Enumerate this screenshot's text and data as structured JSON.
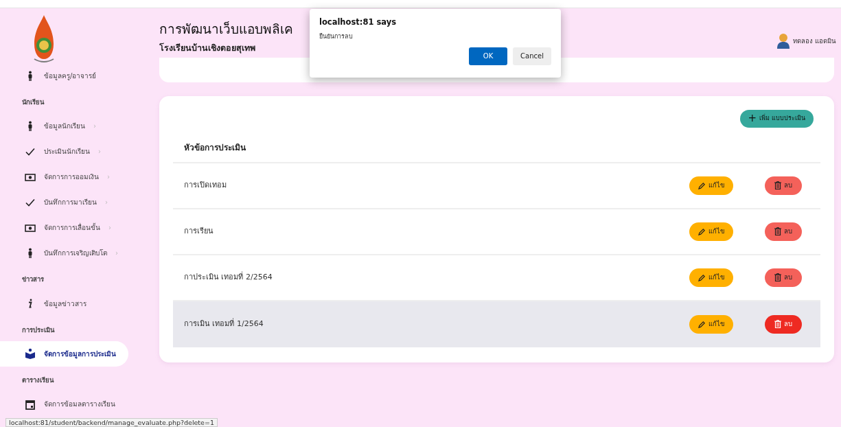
{
  "sidebar": {
    "items": [
      {
        "kind": "person",
        "label": "ข้อมูลครู/อาจารย์",
        "selected": false
      },
      {
        "kind": "section",
        "label": "นักเรียน"
      },
      {
        "kind": "person",
        "label": "ข้อมูลนักเรียน",
        "chevron": "›",
        "selected": false
      },
      {
        "kind": "check",
        "label": "ประเมินนักเรียน",
        "chevron": "›",
        "selected": false
      },
      {
        "kind": "money",
        "label": "จัดการการออมเงิน",
        "chevron": "›",
        "selected": false
      },
      {
        "kind": "check",
        "label": "บันทึกการมาเรียน",
        "chevron": "›",
        "selected": false
      },
      {
        "kind": "money",
        "label": "จัดการการเลื่อนขั้น",
        "chevron": "›",
        "selected": false
      },
      {
        "kind": "person",
        "label": "บันทึกการเจริญเติบโต",
        "chevron": "›",
        "selected": false
      },
      {
        "kind": "section",
        "label": "ข่าวสาร"
      },
      {
        "kind": "info",
        "label": "ข้อมูลข่าวสาร",
        "selected": false
      },
      {
        "kind": "section",
        "label": "การประเมิน"
      },
      {
        "kind": "book",
        "label": "จัดการข้อมูลการประเมิน",
        "selected": true
      },
      {
        "kind": "section",
        "label": "ตารางเรียน"
      },
      {
        "kind": "calendar",
        "label": "จัดการข้อมลตารางเรียน",
        "selected": false
      }
    ]
  },
  "header": {
    "title": "การพัฒนาเว็บแอบพลิเค",
    "subtitle": "โรงเรียนบ้านเชิงดอยสุเทพ",
    "user": "ทดลอง แอดมิน"
  },
  "card": {
    "add_button": "เพิ่ม แบบประเมิน",
    "add_icon": "+",
    "column": "หัวข้อการประเมิน",
    "rows": [
      {
        "title": "การเปิดเทอม",
        "edit": "แก้ไข",
        "delete": "ลบ",
        "selected": false
      },
      {
        "title": "การเรียน",
        "edit": "แก้ไข",
        "delete": "ลบ",
        "selected": false
      },
      {
        "title": "กาประเมิน เทอมที่ 2/2564",
        "edit": "แก้ไข",
        "delete": "ลบ",
        "selected": false
      },
      {
        "title": "การเมิน เทอมที่ 1/2564",
        "edit": "แก้ไข",
        "delete": "ลบ",
        "selected": true
      }
    ]
  },
  "dialog": {
    "title": "localhost:81 says",
    "message": "ยืนยันการลบ",
    "ok": "OK",
    "cancel": "Cancel"
  },
  "status_bar": "localhost:81/student/backend/manage_evaluate.php?delete=1"
}
